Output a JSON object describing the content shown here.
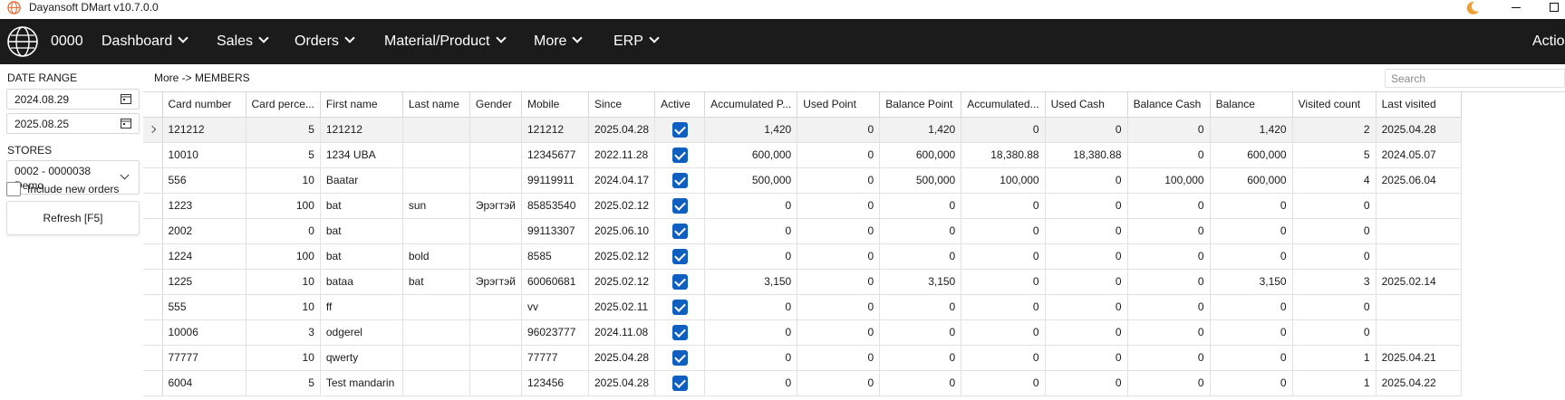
{
  "window": {
    "title": "Dayansoft DMart v10.7.0.0"
  },
  "nav": {
    "code": "0000",
    "items": [
      {
        "label": "Dashboard"
      },
      {
        "label": "Sales"
      },
      {
        "label": "Orders"
      },
      {
        "label": "Material/Product"
      },
      {
        "label": "More"
      },
      {
        "label": "ERP"
      }
    ],
    "actions_label": "Actio"
  },
  "sidebar": {
    "date_range_label": "DATE RANGE",
    "date_from": "2024.08.29",
    "date_to": "2025.08.25",
    "stores_label": "STORES",
    "store_line1": "0002 - 0000038",
    "store_line2": "Demo",
    "include_new_orders_label": "Include new orders",
    "refresh_label": "Refresh [F5]"
  },
  "main": {
    "breadcrumb": "More -> MEMBERS",
    "search_placeholder": "Search"
  },
  "colors": {
    "navbar_bg": "#1b1b1b",
    "checkbox_accent": "#0f5fc0",
    "selected_row": "#f2f2f2"
  },
  "table": {
    "columns": [
      "Card number",
      "Card perce...",
      "First name",
      "Last name",
      "Gender",
      "Mobile",
      "Since",
      "Active",
      "Accumulated P...",
      "Used Point",
      "Balance Point",
      "Accumulated...",
      "Used Cash",
      "Balance Cash",
      "Balance",
      "Visited count",
      "Last visited"
    ],
    "rows": [
      [
        "121212",
        "5",
        "121212",
        "",
        "",
        "121212",
        "2025.04.28",
        true,
        "1,420",
        "0",
        "1,420",
        "0",
        "0",
        "0",
        "1,420",
        "2",
        "2025.04.28"
      ],
      [
        "10010",
        "5",
        "1234 UBA",
        "",
        "",
        "12345677",
        "2022.11.28",
        true,
        "600,000",
        "0",
        "600,000",
        "18,380.88",
        "18,380.88",
        "0",
        "600,000",
        "5",
        "2024.05.07"
      ],
      [
        "556",
        "10",
        "Baatar",
        "",
        "",
        "99119911",
        "2024.04.17",
        true,
        "500,000",
        "0",
        "500,000",
        "100,000",
        "0",
        "100,000",
        "600,000",
        "4",
        "2025.06.04"
      ],
      [
        "1223",
        "100",
        "bat",
        "sun",
        "Эрэгтэй",
        "85853540",
        "2025.02.12",
        true,
        "0",
        "0",
        "0",
        "0",
        "0",
        "0",
        "0",
        "0",
        ""
      ],
      [
        "2002",
        "0",
        "bat",
        "",
        "",
        "99113307",
        "2025.06.10",
        true,
        "0",
        "0",
        "0",
        "0",
        "0",
        "0",
        "0",
        "0",
        ""
      ],
      [
        "1224",
        "100",
        "bat",
        "bold",
        "",
        "8585",
        "2025.02.12",
        true,
        "0",
        "0",
        "0",
        "0",
        "0",
        "0",
        "0",
        "0",
        ""
      ],
      [
        "1225",
        "10",
        "bataa",
        "bat",
        "Эрэгтэй",
        "60060681",
        "2025.02.12",
        true,
        "3,150",
        "0",
        "3,150",
        "0",
        "0",
        "0",
        "3,150",
        "3",
        "2025.02.14"
      ],
      [
        "555",
        "10",
        "ff",
        "",
        "",
        "vv",
        "2025.02.11",
        true,
        "0",
        "0",
        "0",
        "0",
        "0",
        "0",
        "0",
        "0",
        ""
      ],
      [
        "10006",
        "3",
        "odgerel",
        "",
        "",
        "96023777",
        "2024.11.08",
        true,
        "0",
        "0",
        "0",
        "0",
        "0",
        "0",
        "0",
        "0",
        ""
      ],
      [
        "77777",
        "10",
        "qwerty",
        "",
        "",
        "77777",
        "2025.04.28",
        true,
        "0",
        "0",
        "0",
        "0",
        "0",
        "0",
        "0",
        "1",
        "2025.04.21"
      ],
      [
        "6004",
        "5",
        "Test mandarin",
        "",
        "",
        "123456",
        "2025.04.28",
        true,
        "0",
        "0",
        "0",
        "0",
        "0",
        "0",
        "0",
        "1",
        "2025.04.22"
      ]
    ],
    "selected_row": 0
  }
}
